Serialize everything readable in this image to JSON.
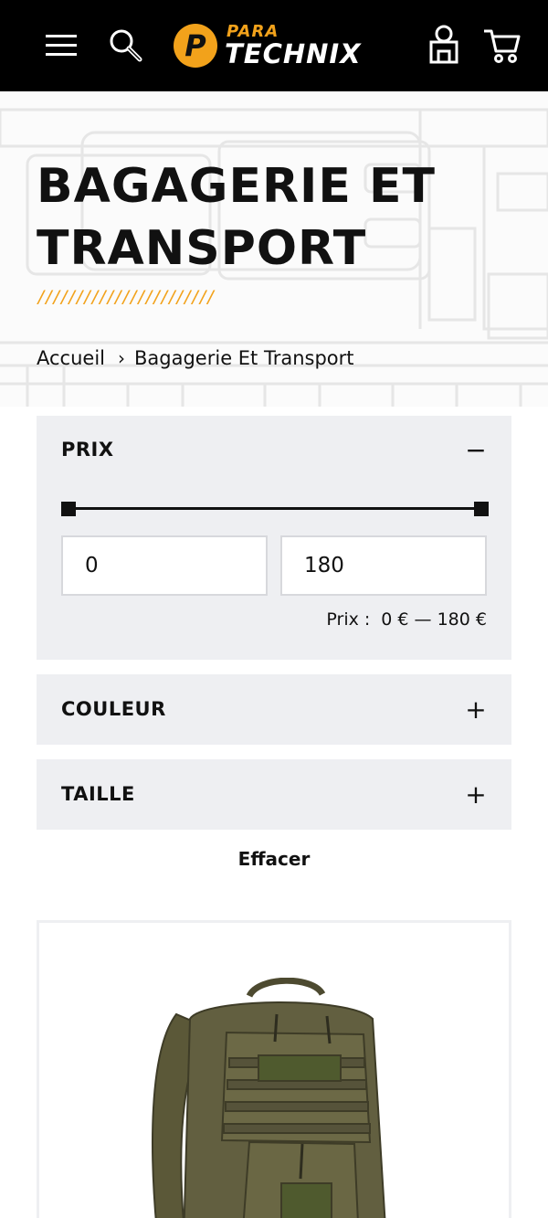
{
  "header": {
    "logo_top": "PARA",
    "logo_bottom": "TECHNIX",
    "logo_mark": "P",
    "icons": [
      "menu-icon",
      "search-icon",
      "account-icon",
      "cart-icon"
    ]
  },
  "hero": {
    "title": "BAGAGERIE ET TRANSPORT",
    "stripes": "///////////////////////",
    "breadcrumb": {
      "home": "Accueil",
      "separator": "›",
      "current": "Bagagerie Et Transport"
    }
  },
  "filters": {
    "price": {
      "title": "PRIX",
      "toggle": "−",
      "min_value": "0",
      "max_value": "180",
      "summary_label": "Prix :",
      "summary_value": "0 € — 180 €",
      "range_min_fraction": 0,
      "range_max_fraction": 1
    },
    "color": {
      "title": "COULEUR",
      "toggle": "+"
    },
    "size": {
      "title": "TAILLE",
      "toggle": "+"
    },
    "clear_label": "Effacer"
  },
  "colors": {
    "accent": "#f2a21b",
    "header_bg": "#000000",
    "panel_bg": "#eeeff2",
    "text": "#111111",
    "product_olive": "#5f5c3d"
  }
}
